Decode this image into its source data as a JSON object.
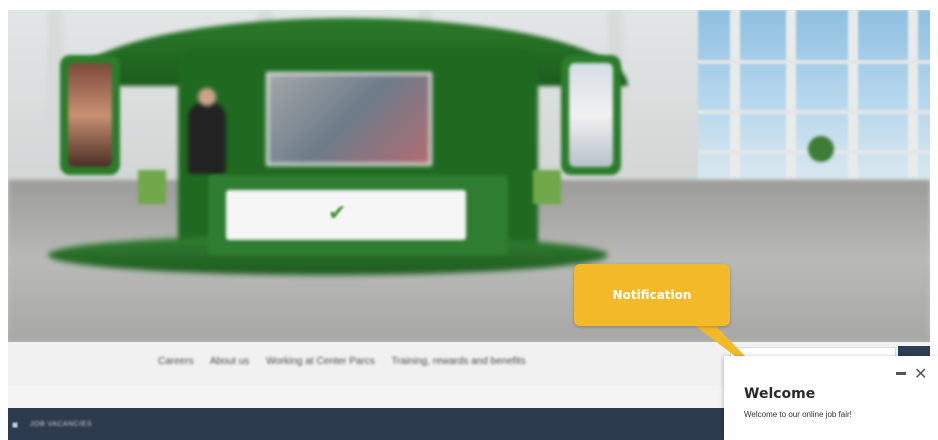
{
  "notification": {
    "label": "Notification",
    "color": "#f2b929"
  },
  "welcome_panel": {
    "title": "Welcome",
    "message": "Welcome to our online job fair!",
    "minimize_icon": "minimize-icon",
    "close_icon": "close-icon",
    "close_glyph": "✕"
  },
  "navigation": {
    "links": [
      "Careers",
      "About us",
      "Working at Center Parcs",
      "Training, rewards and benefits"
    ],
    "next_glyph": "›",
    "next_icon": "chevron-right-icon"
  },
  "bottom_bar": {
    "label": "JOB VACANCIES",
    "icon": "briefcase-icon",
    "color": "#2d3b4e"
  }
}
